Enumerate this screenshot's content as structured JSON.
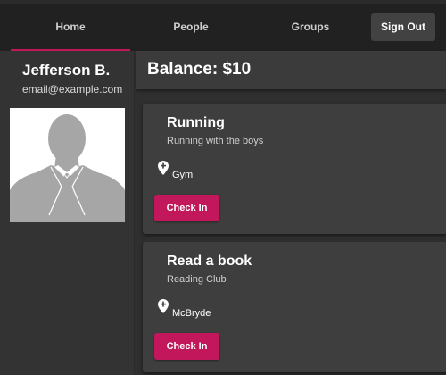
{
  "nav": {
    "tabs": [
      {
        "label": "Home",
        "active": true
      },
      {
        "label": "People",
        "active": false
      },
      {
        "label": "Groups",
        "active": false
      }
    ],
    "sign_out_label": "Sign Out"
  },
  "user": {
    "name": "Jefferson B.",
    "email": "email@example.com",
    "avatar_icon": "person-silhouette-icon"
  },
  "balance": {
    "text": "Balance: $10"
  },
  "groups": [
    {
      "title": "Running",
      "subtitle": "Running with the boys",
      "location": "Gym",
      "location_icon": "map-pin-plus-icon",
      "check_in_label": "Check In"
    },
    {
      "title": "Read a book",
      "subtitle": "Reading Club",
      "location": "McBryde",
      "location_icon": "map-pin-plus-icon",
      "check_in_label": "Check In"
    }
  ],
  "colors": {
    "accent": "#c2185b",
    "nav_bg": "#212121",
    "card_bg": "#3e3e3e"
  }
}
